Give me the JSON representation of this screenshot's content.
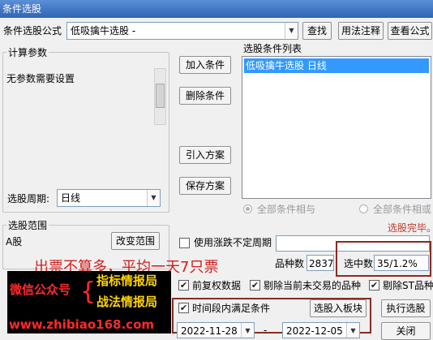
{
  "window": {
    "title": "条件选股"
  },
  "formula": {
    "label": "条件选股公式",
    "value": "低吸擒牛选股 -",
    "find_button": "查找",
    "usage_button": "用法注释",
    "view_button": "查看公式"
  },
  "params": {
    "group_label": "计算参数",
    "no_params_text": "无参数需要设置",
    "period_label": "选股周期:",
    "period_value": "日线"
  },
  "actions": {
    "add_condition": "加入条件",
    "delete_condition": "删除条件",
    "import_plan": "引入方案",
    "save_plan": "保存方案"
  },
  "conditions": {
    "label": "选股条件列表",
    "items": [
      "低吸擒牛选股  日线"
    ],
    "and_label": "全部条件相与",
    "or_label": "全部条件相或",
    "done_status": "选股完毕。"
  },
  "range": {
    "group_label": "选股范围",
    "value": "A股",
    "change_button": "改变范围",
    "limit_period_label": "使用涨跌不定周期",
    "limit_period_value": ""
  },
  "stats": {
    "count_label": "品种数",
    "count_value": "2837",
    "selected_label": "选中数",
    "selected_value": "35/1.2%"
  },
  "options": {
    "pre_adjust": "前复权数据",
    "exclude_untraded": "剔除当前未交易的品种",
    "exclude_st": "剔除ST品种"
  },
  "time_range": {
    "label": "时间段内满足条件",
    "start_date": "2022-11-28",
    "end_date": "2022-12-05"
  },
  "buttons": {
    "select_to_block": "选股入板块",
    "execute": "执行选股",
    "close": "关闭"
  },
  "overlay": {
    "headline": "出票不算多，平均一天7只票",
    "wechat_label": "微信公众号",
    "line1": "指标情报局",
    "line2": "战法情报局",
    "url": "www.zhibiao168.com"
  },
  "colors": {
    "title_bar": "#2f64b5",
    "selection": "#3399ff",
    "status_red": "#c0392b",
    "highlight_box": "#8b2a22",
    "overlay_red": "#d21e1e",
    "overlay_yellow": "#ffd400"
  }
}
